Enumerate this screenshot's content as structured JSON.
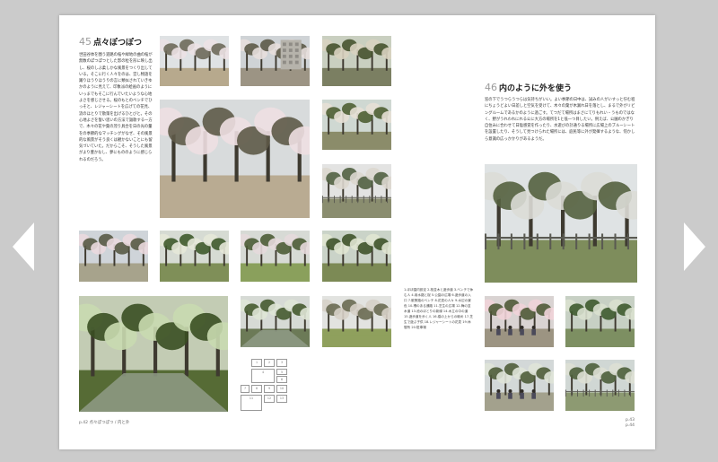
{
  "navigation": {
    "prev_icon": "chevron-left-icon",
    "next_icon": "chevron-right-icon"
  },
  "left_section": {
    "number": "45",
    "title": "点々ぽつぽつ",
    "body": "世田谷体を圏う遊路の桜や緑地の曲の桜が無数のぽつぽつとした影の粒を形に映し出し、桜のしぶ柔しかな風景をつくり出している。そこに行く人々をのは、営し物語を踊りほうりほうりの言に類似されていきゆかのように見えて、印象派の絵画のようにいっまでもそこに行んでいたいような心地よさを感じさせる。桜のもとのベンチでひっそと、レジャーシートを広げての花見、流のほとりで散策を出げるひとびと。その心地よさを誓い思いの方法で謳歌する一方で、木々の花や葉の茂り具合を日の光の量をの季節的なマッチングがなぜ、その風景的な風景がそう良くは観かないことにも留気づいていた。だからこそ、そうした風景がより豊かなし、夢にもののように感じられるのだろう。"
  },
  "right_section": {
    "number": "46",
    "title": "内のように外を使う",
    "body": "窓の下でうつらうつらは気持ちがいい。よい季節の日中は、試みの人がいすっと佇む程にちょうどよい日差しと空気を受けて、木々の葉が木漏れ日を落とし、まるで外がリビングルームであるかのように過ごす。てつだて場所はまさにてりもれい・うものではなく、野がうれわれにれる公に大方の場所を1と低一つ目したい。例えば、公園のかぎり自住みに合わせて日陰感覚を作ったり、水遊びの計通りる場所に広場上のブルーシートを設置したり、そうして見つけられた場所には、庭民等に外が発揮するような、何かしら意識の広っかかりがあるようだ。"
  },
  "captions": "1.ほほ園内設定 2.桜並木と遊歩道 3.ベンチで休む人 4.用水路と桜 5.公園の広場 6.遊歩道の入口 7.散策路のベンチ 8.花見の人々 9.水辺の景色 10.柵のある通路 11.芝生の広場 12.梅の並木道 13.池のほとりの新緑 14.木立の中の道 15.遊歩道を歩く人 16.橋の上からの眺め 17.芝生で遊ぶ子供 18.レジャーシートの花見 19.休憩所 20.駐車場",
  "folio_left": "p.42 点々ぽつぽつ / 内と外",
  "folio_right_lines": [
    "p.43",
    "p.44"
  ],
  "map_cells": [
    "1",
    "2",
    "3",
    "4",
    "5",
    "6",
    "7",
    "8",
    "9",
    "10",
    "11",
    "12",
    "13"
  ],
  "photos": [
    {
      "id": 1,
      "kind": "blossom",
      "sky": "#dfe2e4",
      "ground": "#b7a98d",
      "foliage": "#6e6a5a",
      "bloom": "#ece2e4"
    },
    {
      "id": 2,
      "kind": "building",
      "sky": "#cfd3d6",
      "ground": "#9c9484",
      "foliage": "#5c5a48",
      "bloom": "#e7dfdd"
    },
    {
      "id": 3,
      "kind": "green",
      "sky": "#c9cfc0",
      "ground": "#7b7f62",
      "foliage": "#46522f",
      "bloom": "#d8d2c0"
    },
    {
      "id": 4,
      "kind": "blossom",
      "sky": "#d8dbdc",
      "ground": "#b9ab92",
      "foliage": "#5e5a48",
      "bloom": "#eedfe2"
    },
    {
      "id": 5,
      "kind": "green",
      "sky": "#cfd8d2",
      "ground": "#8b8c6a",
      "foliage": "#4e5f33",
      "bloom": "#e5e0d5"
    },
    {
      "id": 6,
      "kind": "fence",
      "sky": "#e3e3e2",
      "ground": "#8a8d6f",
      "foliage": "#516042",
      "bloom": "#dcd7cf"
    },
    {
      "id": 7,
      "kind": "blossom",
      "sky": "#cfd4d9",
      "ground": "#a7a38c",
      "foliage": "#585a45",
      "bloom": "#ead9de"
    },
    {
      "id": 8,
      "kind": "green",
      "sky": "#d6dbd3",
      "ground": "#7f8f58",
      "foliage": "#3f5a2c",
      "bloom": "#e5e8d8"
    },
    {
      "id": 9,
      "kind": "park",
      "sky": "#d7dad5",
      "ground": "#8aa05c",
      "foliage": "#4c5c36",
      "bloom": "#e6d9dc"
    },
    {
      "id": 10,
      "kind": "green",
      "sky": "#cad3c8",
      "ground": "#7c8a55",
      "foliage": "#3f532a",
      "bloom": "#e0e6d2"
    },
    {
      "id": 11,
      "kind": "river",
      "sky": "#d6dad5",
      "ground": "#6c7a57",
      "foliage": "#465a30",
      "bloom": "#dfe5d6"
    },
    {
      "id": 12,
      "kind": "pond",
      "sky": "#c3ccb4",
      "ground": "#566b35",
      "foliage": "#3a4f22",
      "bloom": "#c9dab0"
    },
    {
      "id": 13,
      "kind": "park",
      "sky": "#e2e3e0",
      "ground": "#8fa05d",
      "foliage": "#6a6a52",
      "bloom": "#d7d0c8"
    },
    {
      "id": 14,
      "kind": "fence",
      "sky": "#dfe3e4",
      "ground": "#7e8d5c",
      "foliage": "#54603f",
      "bloom": "#dcdcd6"
    },
    {
      "id": 15,
      "kind": "people",
      "sky": "#d9d3d2",
      "ground": "#9c9482",
      "foliage": "#4f5a37",
      "bloom": "#efd3d8"
    },
    {
      "id": 16,
      "kind": "green",
      "sky": "#c7d0c4",
      "ground": "#7d8f62",
      "foliage": "#3e5a2f",
      "bloom": "#d9e0cf"
    },
    {
      "id": 17,
      "kind": "people",
      "sky": "#d3d8d8",
      "ground": "#a3a18d",
      "foliage": "#4f5d3a",
      "bloom": "#dfe4d8"
    },
    {
      "id": 18,
      "kind": "fence",
      "sky": "#d0d7d4",
      "ground": "#8d9a72",
      "foliage": "#4c5f3b",
      "bloom": "#dde0d4"
    },
    {
      "id": 19,
      "kind": "people",
      "sky": "#e0dad9",
      "ground": "#9cab9e",
      "foliage": "#5a5b48",
      "bloom": "#edd6db"
    }
  ]
}
